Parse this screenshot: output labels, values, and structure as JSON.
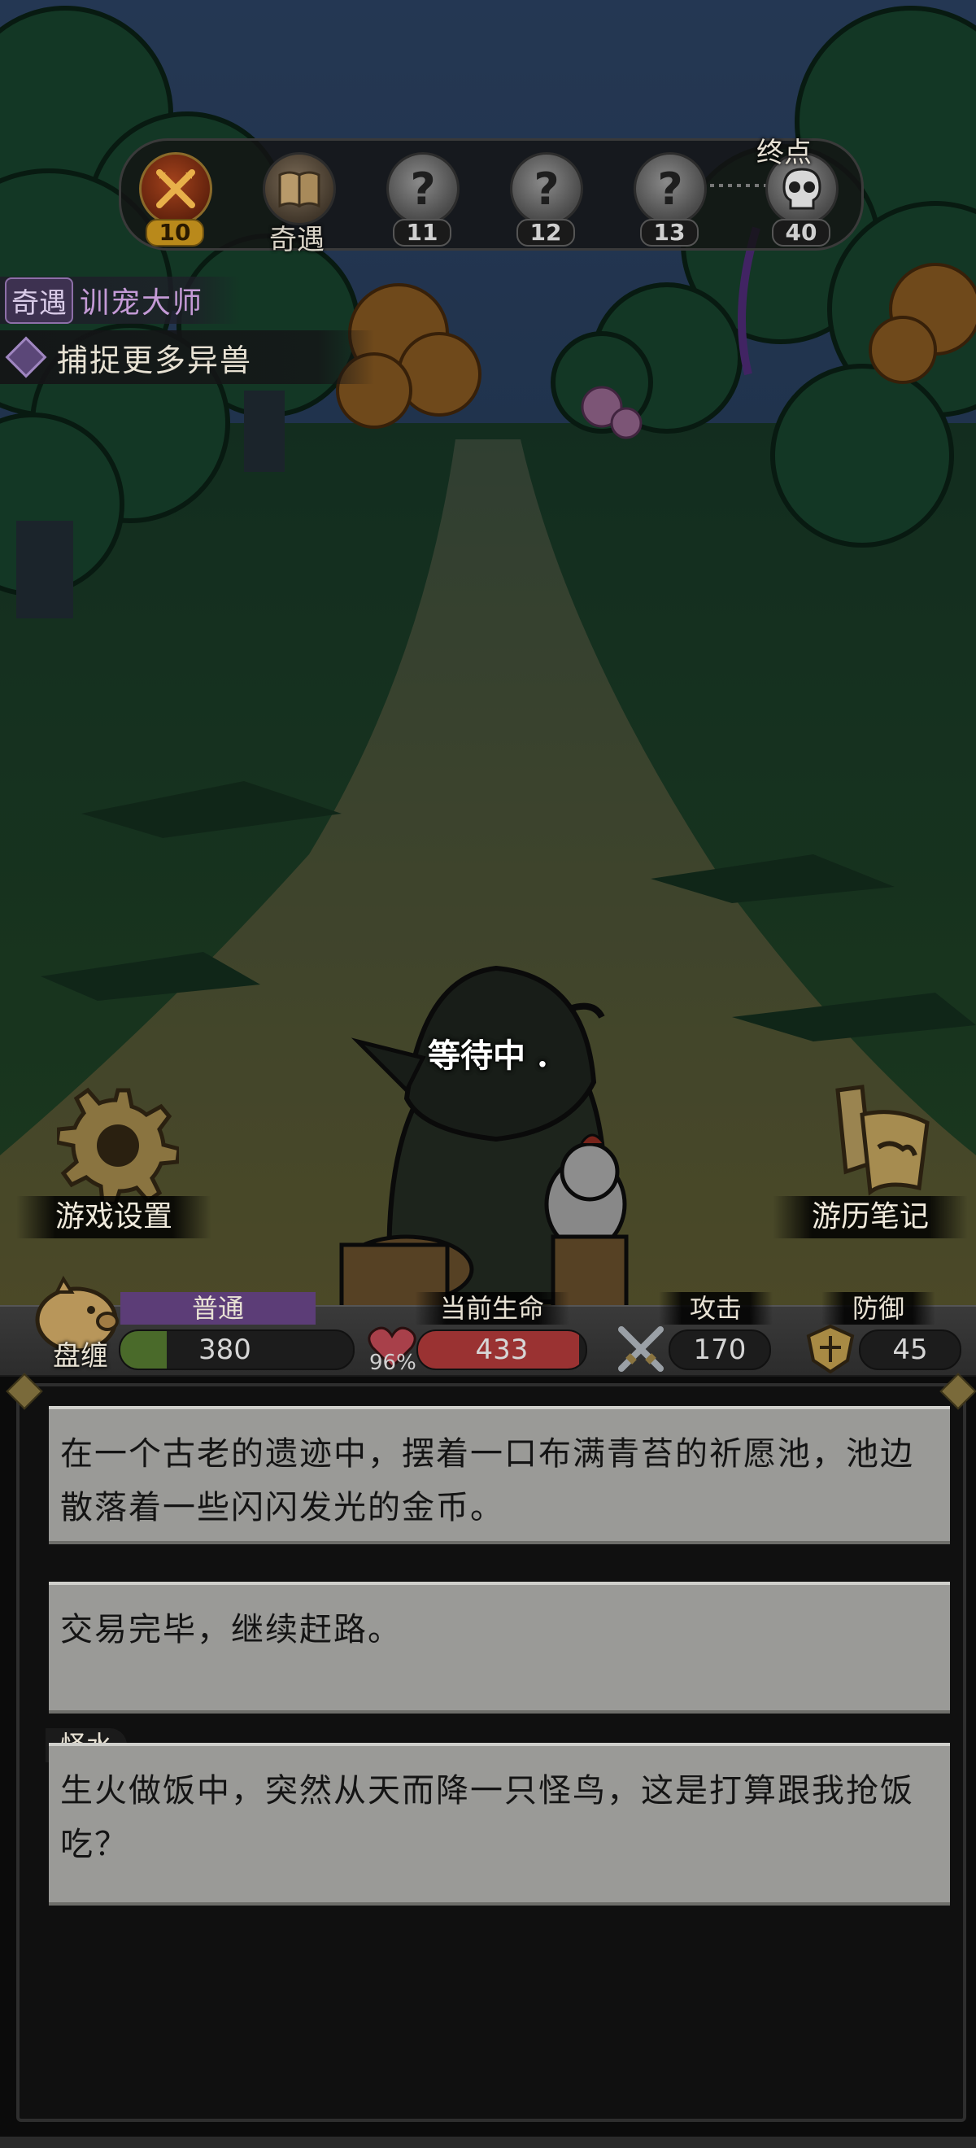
{
  "progress": {
    "nodes": [
      {
        "kind": "current",
        "number": "10",
        "icon": "crossed-swords-icon"
      },
      {
        "kind": "encounter",
        "label": "奇遇",
        "icon": "book-icon"
      },
      {
        "kind": "unknown",
        "number": "11",
        "glyph": "?",
        "icon": "question-icon"
      },
      {
        "kind": "unknown",
        "number": "12",
        "glyph": "?",
        "icon": "question-icon"
      },
      {
        "kind": "unknown",
        "number": "13",
        "glyph": "?",
        "icon": "question-icon"
      },
      {
        "kind": "boss",
        "number": "40",
        "icon": "skull-icon"
      }
    ],
    "endpoint_label": "终点"
  },
  "quest": {
    "type": "奇遇",
    "name": "训宠大师",
    "objective": "捕捉更多异兽"
  },
  "status_text": "等待中 .",
  "buttons": {
    "settings": {
      "label": "游戏设置",
      "icon": "gear-icon"
    },
    "journal": {
      "label": "游历笔记",
      "icon": "scroll-icon"
    }
  },
  "stats": {
    "pet_label": "盘缠",
    "pet_icon": "piggy-bank-icon",
    "rank_label": "普通",
    "gold": "380",
    "gold_fill": 0.2,
    "hp_label": "当前生命",
    "hp": "433",
    "hp_percent": "96%",
    "hp_fill": 0.96,
    "attack_label": "攻击",
    "attack": "170",
    "defense_label": "防御",
    "defense": "45",
    "colors": {
      "gold_fill": "#4a6a2a",
      "hp_fill": "#9a3232",
      "rank_bg": "#5c3d77"
    }
  },
  "log": [
    {
      "tag": "",
      "text": "在一个古老的遗迹中，摆着一口布满青苔的祈愿池，池边散落着一些闪闪发光的金币。"
    },
    {
      "tag": "",
      "text": "交易完毕，继续赶路。"
    },
    {
      "tag": "怪水",
      "text": "生火做饭中，突然从天而降一只怪鸟，这是打算跟我抢饭吃？"
    }
  ]
}
